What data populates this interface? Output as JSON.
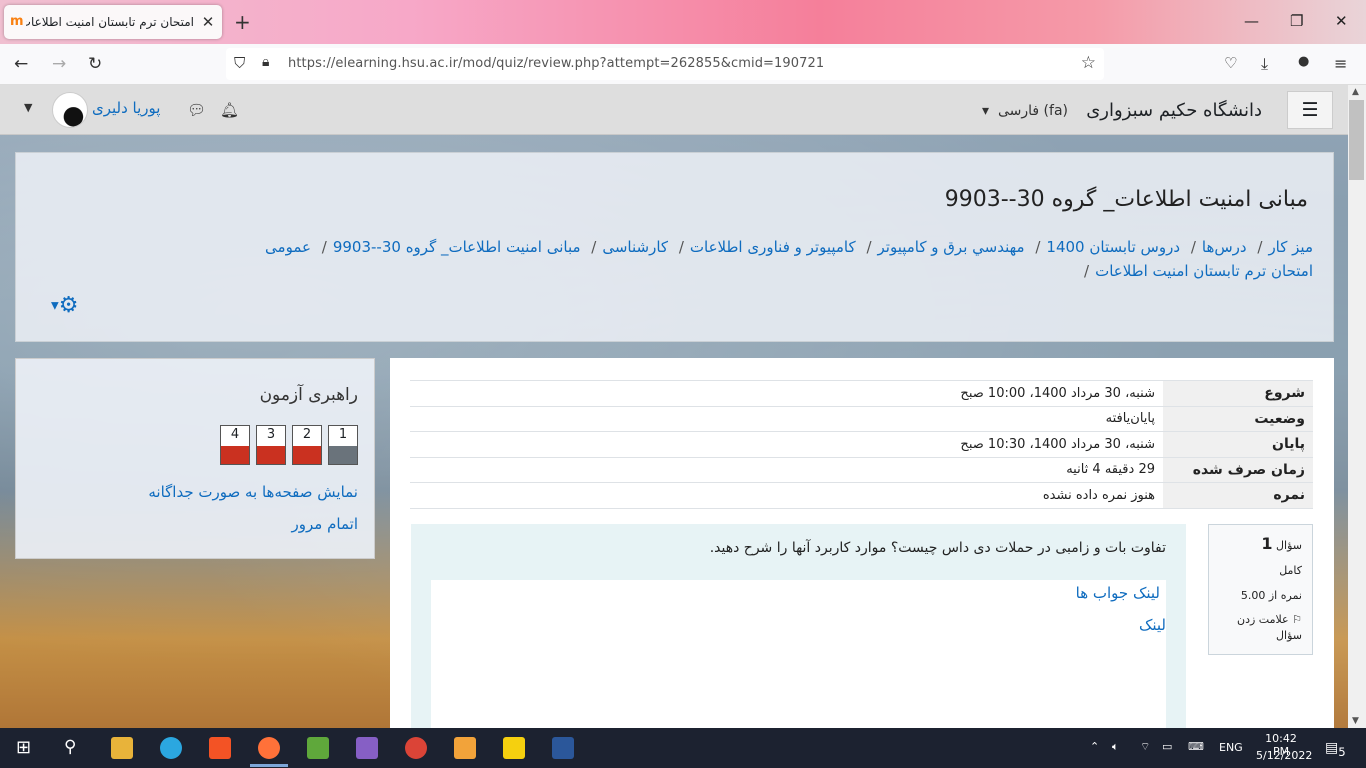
{
  "browser": {
    "tab_title": "امتحان ترم تابستان امنیت اطلاعات",
    "favicon_letter": "m",
    "url": "https://elearning.hsu.ac.ir/mod/quiz/review.php?attempt=262855&cmid=190721",
    "colors": {
      "tab_gradient_accent": "#f57f9a"
    }
  },
  "header": {
    "site_name": "دانشگاه حکیم سبزواری",
    "language": "فارسی (fa)",
    "user_name": "پوریا دلیری"
  },
  "course": {
    "title": "مبانی امنیت اطلاعات_ گروه 30--9903",
    "breadcrumb": [
      "میز کار",
      "درس‌ها",
      "دروس تابستان 1400",
      "مهندسي برق و کامپیوتر",
      "کامپیوتر و فناوری اطلاعات",
      "کارشناسی",
      "مبانی امنیت اطلاعات_ گروه 30--9903",
      "عمومی",
      "امتحان ترم تابستان امنیت اطلاعات"
    ]
  },
  "quiz_nav": {
    "title": "راهبری آزمون",
    "questions": [
      {
        "num": "1",
        "state": "grey"
      },
      {
        "num": "2",
        "state": "red"
      },
      {
        "num": "3",
        "state": "red"
      },
      {
        "num": "4",
        "state": "red"
      }
    ],
    "show_pages_label": "نمایش صفحه‌ها به صورت جداگانه",
    "finish_review_label": "اتمام مرور",
    "colors": {
      "grey": "#6a737b",
      "red": "#ca3120"
    }
  },
  "summary": [
    {
      "label": "شروع",
      "value": "شنبه، 30 مرداد 1400، 10:00 صبح"
    },
    {
      "label": "وضعیت",
      "value": "پایان‌یافته"
    },
    {
      "label": "پایان",
      "value": "شنبه، 30 مرداد 1400، 10:30 صبح"
    },
    {
      "label": "زمان صرف شده",
      "value": "29 دقیقه 4 ثانیه"
    },
    {
      "label": "نمره",
      "value": "هنوز نمره داده نشده"
    }
  ],
  "question": {
    "prefix": "سؤال",
    "number": "1",
    "status": "کامل",
    "mark": "نمره از 5.00",
    "flag_label": "علامت زدن سؤال",
    "text": "تفاوت بات و زامبی در حملات دی داس چیست؟ موارد کاربرد آنها را شرح دهید.",
    "answer_links": [
      "لینک جواب ها",
      "لینک"
    ]
  },
  "taskbar": {
    "time": "10:42 PM",
    "date": "5/12/2022",
    "lang": "ENG",
    "notifications": "5"
  }
}
